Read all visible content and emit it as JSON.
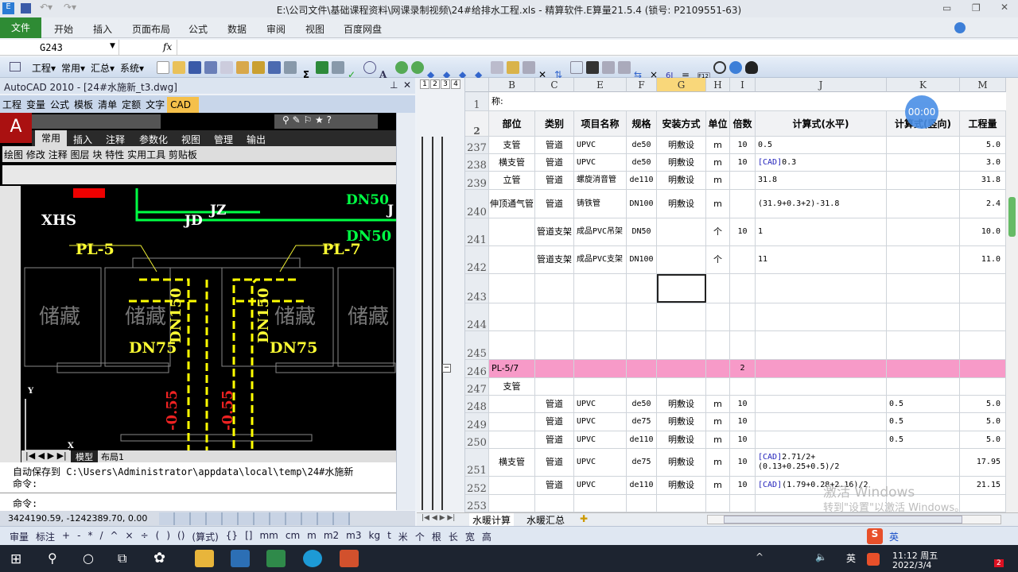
{
  "window": {
    "title": "E:\\公司文件\\基础课程资料\\网课录制视频\\24#给排水工程.xls  -  精算软件.E算量21.5.4  (锁号: P2109551-63)"
  },
  "ribbon": {
    "file": "文件",
    "tabs": [
      "开始",
      "插入",
      "页面布局",
      "公式",
      "数据",
      "审阅",
      "视图",
      "百度网盘"
    ]
  },
  "formula_bar": {
    "name_box": "G243",
    "fx": "fx",
    "value": ""
  },
  "toolbar": {
    "menus": [
      "工程▾",
      "常用▾",
      "汇总▾",
      "系统▾"
    ]
  },
  "cad": {
    "title": "AutoCAD 2010 - [24#水施新_t3.dwg]",
    "side_tabs": [
      "工程",
      "变量",
      "公式",
      "模板",
      "清单",
      "定额",
      "文字",
      "CAD"
    ],
    "ribbon_tabs": [
      "常用",
      "插入",
      "注释",
      "参数化",
      "视图",
      "管理",
      "输出"
    ],
    "panels": [
      "绘图",
      "修改",
      "注释",
      "图层",
      "块",
      "特性",
      "实用工具",
      "剪贴板"
    ],
    "drawing_labels": {
      "xhs": "XHS",
      "jz": "JZ",
      "jd": "JD",
      "dn50a": "DN50",
      "dn50b": "DN50",
      "pl5": "PL-5",
      "pl7": "PL-7",
      "room": "储藏",
      "dn150": "DN150",
      "dn75v": "DN75",
      "dn75": "DN75",
      "elev": "-0.55",
      "j": "J",
      "y": "Y",
      "x": "X"
    },
    "layout_tabs": [
      "模型",
      "布局1"
    ],
    "command_history": [
      "自动保存到 C:\\Users\\Administrator\\appdata\\local\\temp\\24#水施新",
      "命令:"
    ],
    "command_prompt": "命令:",
    "coords": "3424190.59, -1242389.70, 0.00"
  },
  "outline_levels": [
    "1",
    "2",
    "3",
    "4"
  ],
  "sheet": {
    "columns": [
      "B",
      "C",
      "E",
      "F",
      "G",
      "H",
      "I",
      "J",
      "K",
      "M"
    ],
    "selected_column": "G",
    "row1": {
      "num": "1",
      "text": "称:"
    },
    "header": {
      "num": "2",
      "cells": [
        "部位",
        "类别",
        "项目名称",
        "规格",
        "安装方式",
        "单位",
        "倍数",
        "计算式(水平)",
        "计算式(竖向)",
        "工程量"
      ]
    },
    "rows": [
      {
        "num": "237",
        "cells": [
          "支管",
          "管道",
          "UPVC",
          "de50",
          "明敷设",
          "m",
          "10",
          "0.5",
          "",
          "5.0"
        ]
      },
      {
        "num": "238",
        "cells": [
          "横支管",
          "管道",
          "UPVC",
          "de50",
          "明敷设",
          "m",
          "10",
          "[CAD]0.3",
          "",
          "3.0"
        ]
      },
      {
        "num": "239",
        "cells": [
          "立管",
          "管道",
          "螺旋消音管",
          "de110",
          "明敷设",
          "m",
          "",
          "31.8",
          "",
          "31.8"
        ]
      },
      {
        "num": "240",
        "cells": [
          "伸顶通气管",
          "管道",
          "铸铁管",
          "DN100",
          "明敷设",
          "m",
          "",
          "(31.9+0.3+2)-31.8",
          "",
          "2.4"
        ]
      },
      {
        "num": "241",
        "cells": [
          "",
          "管道支架",
          "成品PVC吊架",
          "DN50",
          "",
          "个",
          "10",
          "1",
          "",
          "10.0"
        ]
      },
      {
        "num": "242",
        "cells": [
          "",
          "管道支架",
          "成品PVC支架",
          "DN100",
          "",
          "个",
          "",
          "11",
          "",
          "11.0"
        ]
      },
      {
        "num": "243",
        "cells": [
          "",
          "",
          "",
          "",
          "",
          "",
          "",
          "",
          "",
          ""
        ]
      },
      {
        "num": "244",
        "cells": [
          "",
          "",
          "",
          "",
          "",
          "",
          "",
          "",
          "",
          ""
        ]
      },
      {
        "num": "245",
        "cells": [
          "",
          "",
          "",
          "",
          "",
          "",
          "",
          "",
          "",
          ""
        ]
      },
      {
        "num": "246",
        "cells": [
          "PL-5/7",
          "",
          "",
          "",
          "",
          "",
          "2",
          "",
          "",
          ""
        ]
      },
      {
        "num": "247",
        "cells": [
          "支管",
          "",
          "",
          "",
          "",
          "",
          "",
          "",
          "",
          ""
        ]
      },
      {
        "num": "248",
        "cells": [
          "",
          "管道",
          "UPVC",
          "de50",
          "明敷设",
          "m",
          "10",
          "",
          "0.5",
          "5.0"
        ]
      },
      {
        "num": "249",
        "cells": [
          "",
          "管道",
          "UPVC",
          "de75",
          "明敷设",
          "m",
          "10",
          "",
          "0.5",
          "5.0"
        ]
      },
      {
        "num": "250",
        "cells": [
          "",
          "管道",
          "UPVC",
          "de110",
          "明敷设",
          "m",
          "10",
          "",
          "0.5",
          "5.0"
        ]
      },
      {
        "num": "251",
        "cells": [
          "横支管",
          "管道",
          "UPVC",
          "de75",
          "明敷设",
          "m",
          "10",
          "[CAD]2.71/2+(0.13+0.25+0.5)/2",
          "",
          "17.95"
        ]
      },
      {
        "num": "252",
        "cells": [
          "",
          "管道",
          "UPVC",
          "de110",
          "明敷设",
          "m",
          "10",
          "[CAD](1.79+0.28+2.16)/2",
          "",
          "21.15"
        ]
      },
      {
        "num": "253",
        "cells": [
          "",
          "",
          "",
          "",
          "",
          "",
          "",
          "",
          "",
          ""
        ]
      }
    ],
    "highlight_color": "#f79ac8",
    "tabs": [
      "水暖计算",
      "水暖汇总"
    ]
  },
  "timer": "00:00",
  "watermark": [
    "激活 Windows",
    "转到\"设置\"以激活 Windows。"
  ],
  "status_bar": {
    "items": [
      "审量",
      "标注",
      "+",
      "-",
      "*",
      "/",
      "^",
      "×",
      "÷",
      "(",
      ")",
      "()",
      "(算式)",
      "{}",
      "[]",
      "mm",
      "cm",
      "m",
      "m2",
      "m3",
      "kg",
      "t",
      "米",
      "个",
      "根",
      "长",
      "宽",
      "高"
    ],
    "ime": "英"
  },
  "taskbar": {
    "time": "11:12 周五",
    "date": "2022/3/4",
    "lang": "英",
    "notifications": "2"
  }
}
